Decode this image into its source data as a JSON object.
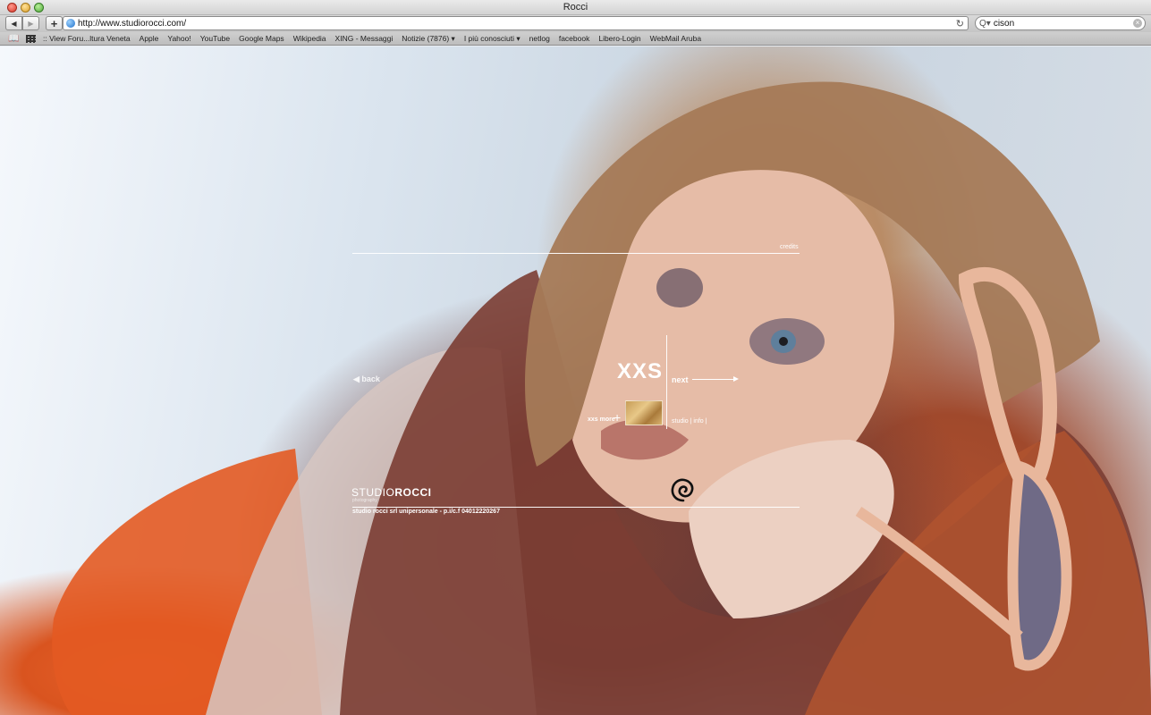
{
  "window": {
    "title": "Rocci"
  },
  "toolbar": {
    "back_glyph": "◀",
    "forward_glyph": "▶",
    "add_glyph": "+",
    "url": "http://www.studiorocci.com/",
    "reload_glyph": "↻",
    "search_glyph": "Q▾",
    "search_value": "cison",
    "clear_glyph": "×"
  },
  "bookmarks": {
    "book_glyph": "📖",
    "items": [
      ":: View Foru...ltura Veneta",
      "Apple",
      "Yahoo!",
      "YouTube",
      "Google Maps",
      "Wikipedia",
      "XING - Messaggi",
      "Notizie (7876) ▾",
      "I più conosciuti ▾",
      "netlog",
      "facebook",
      "Libero-Login",
      "WebMail Aruba"
    ]
  },
  "site": {
    "credits": "credits",
    "back": "◀ back",
    "section_title": "XXS",
    "next": "next",
    "more": "xxs more",
    "plus": "+",
    "studio_info": "studio | info |",
    "brand_part1": "STUDIO",
    "brand_part2": "ROCCI",
    "brand_sub": "photography",
    "legal": "studio rocci srl unipersonale - p.i/c.f 04012220267"
  }
}
